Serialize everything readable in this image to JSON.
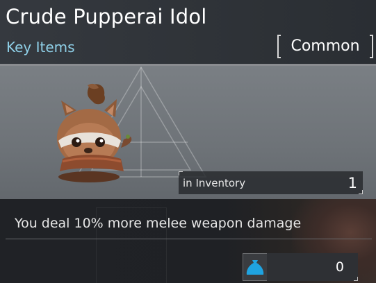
{
  "item": {
    "name": "Crude Pupperai Idol",
    "category": "Key Items",
    "rarity": "Common",
    "inventory_label": "in Inventory",
    "inventory_count": "1",
    "description": "You deal 10% more melee weapon damage",
    "price": "0"
  },
  "icons": {
    "item_image": "pupperai-idol-figurine",
    "price_icon": "money-bag-icon"
  },
  "colors": {
    "category_text": "#8fd0e8",
    "price_icon": "#1fa3e0"
  }
}
